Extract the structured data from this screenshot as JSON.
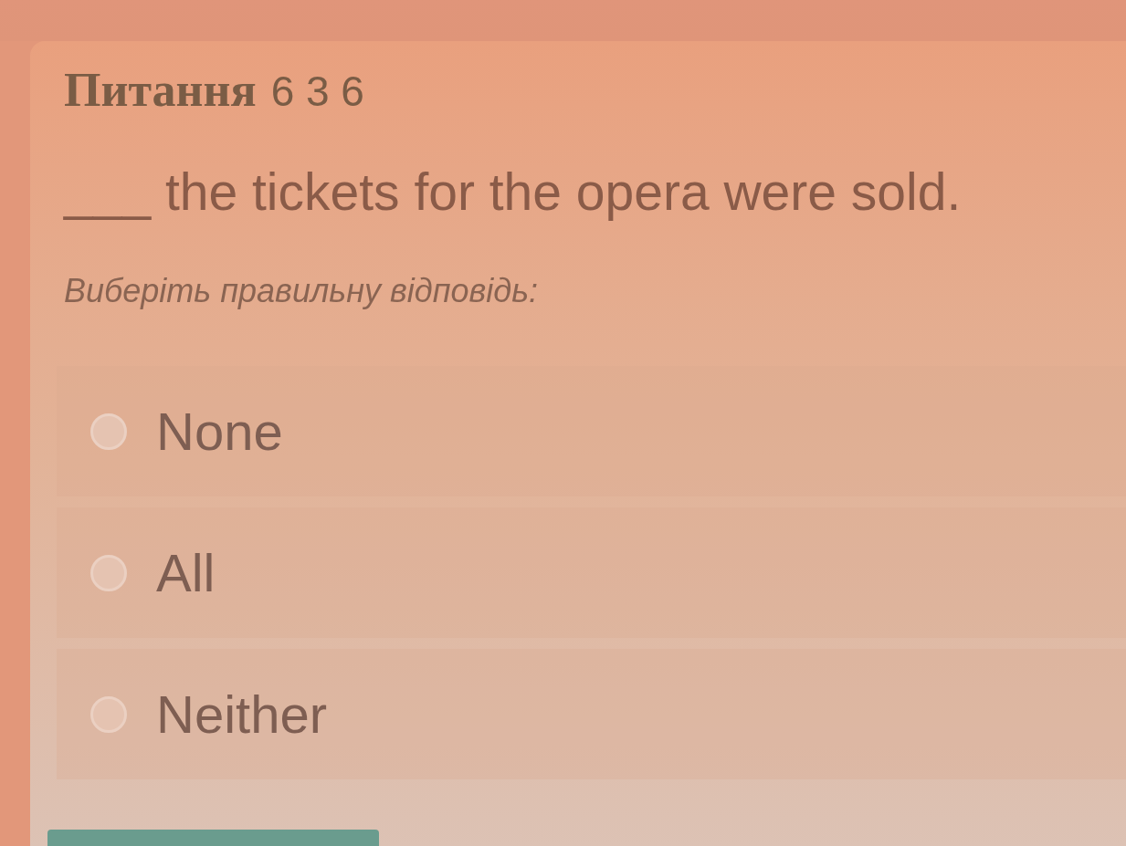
{
  "question": {
    "title": "Питання",
    "counter": "6 3 6",
    "text": "___ the tickets for the opera were sold.",
    "instruction": "Виберіть правильну відповідь:"
  },
  "options": [
    {
      "label": "None",
      "selected": false
    },
    {
      "label": "All",
      "selected": false
    },
    {
      "label": "Neither",
      "selected": false
    }
  ]
}
